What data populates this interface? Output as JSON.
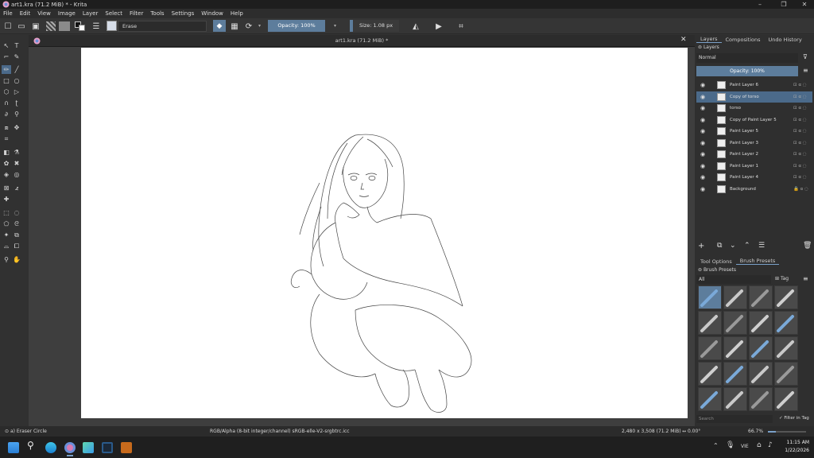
{
  "window": {
    "title": "art1.kra (71.2 MiB) * - Krita",
    "minimize": "–",
    "maximize": "❐",
    "close": "✕"
  },
  "menu": [
    "File",
    "Edit",
    "View",
    "Image",
    "Layer",
    "Select",
    "Filter",
    "Tools",
    "Settings",
    "Window",
    "Help"
  ],
  "toolbar": {
    "preset_name": "Erase",
    "opacity": "Opacity: 100%",
    "size": "Size: 1.08 px"
  },
  "document": {
    "tab_title": "art1.kra (71.2 MiB) *",
    "close": "✕"
  },
  "panel": {
    "tabs": [
      "Layers",
      "Compositions",
      "Undo History"
    ],
    "layers_header": "Layers",
    "blend_mode": "Normal",
    "opacity": "Opacity:  100%",
    "layers": [
      {
        "name": "Paint Layer 6",
        "selected": false,
        "locked": false
      },
      {
        "name": "Copy of torso",
        "selected": true,
        "locked": false
      },
      {
        "name": "torso",
        "selected": false,
        "locked": false
      },
      {
        "name": "Copy of Paint Layer 5",
        "selected": false,
        "locked": false
      },
      {
        "name": "Paint Layer 5",
        "selected": false,
        "locked": false
      },
      {
        "name": "Paint Layer 3",
        "selected": false,
        "locked": false
      },
      {
        "name": "Paint Layer 2",
        "selected": false,
        "locked": false
      },
      {
        "name": "Paint Layer 1",
        "selected": false,
        "locked": false
      },
      {
        "name": "Paint Layer 4",
        "selected": false,
        "locked": false
      },
      {
        "name": "Background",
        "selected": false,
        "locked": true
      }
    ],
    "bottom_tabs": [
      "Tool Options",
      "Brush Presets"
    ],
    "brush_presets_header": "Brush Presets",
    "filter_all": "All",
    "tag": "Tag",
    "search_placeholder": "Search",
    "filter_in_tag": "Filter in Tag"
  },
  "status": {
    "tool": "a) Eraser Circle",
    "color": "RGB/Alpha (8-bit integer/channel)  sRGB-elle-V2-srgbtrc.icc",
    "dimensions": "2,480 x 3,508 (71.2 MiB)",
    "rotation": "0.00°",
    "zoom": "66.7%"
  },
  "taskbar": {
    "lang": "VIE",
    "time": "11:15 AM",
    "date": "1/22/2026"
  },
  "colors": {
    "accent": "#5d7d9c",
    "selected_layer": "#4b6a8a"
  }
}
